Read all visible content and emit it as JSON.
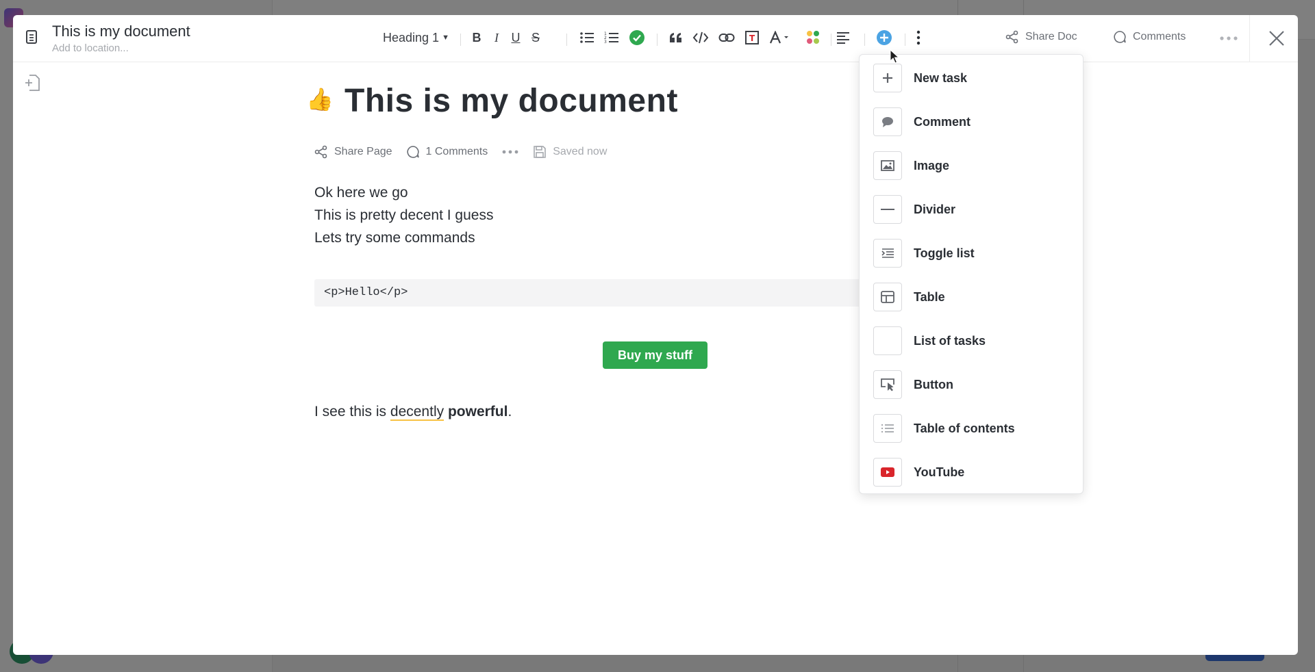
{
  "header": {
    "doc_title": "This is my document",
    "location_placeholder": "Add to location...",
    "heading_select": "Heading 1",
    "bold": "B",
    "italic": "I",
    "underline": "U",
    "strike": "S",
    "share_doc": "Share Doc",
    "comments": "Comments"
  },
  "page": {
    "emoji": "👍",
    "title": "This is my document",
    "share_page": "Share Page",
    "comments_count": "1 Comments",
    "saved": "Saved now",
    "lines": [
      "Ok here we go",
      "This is pretty decent I guess",
      "Lets try some commands"
    ],
    "code": "<p>Hello</p>",
    "button_label": "Buy my stuff",
    "final_line": {
      "prefix": "I see this is ",
      "highlight": "decently",
      "space": " ",
      "bold": "powerful",
      "suffix": "."
    }
  },
  "insert_menu": {
    "items": [
      {
        "label": "New task",
        "icon": "plus-icon"
      },
      {
        "label": "Comment",
        "icon": "comment-icon"
      },
      {
        "label": "Image",
        "icon": "image-icon"
      },
      {
        "label": "Divider",
        "icon": "divider-icon"
      },
      {
        "label": "Toggle list",
        "icon": "toggle-list-icon"
      },
      {
        "label": "Table",
        "icon": "table-icon"
      },
      {
        "label": "List of tasks",
        "icon": "list-of-tasks-icon"
      },
      {
        "label": "Button",
        "icon": "button-icon"
      },
      {
        "label": "Table of contents",
        "icon": "table-of-contents-icon"
      },
      {
        "label": "YouTube",
        "icon": "youtube-icon"
      }
    ]
  },
  "colors": {
    "accent": "#4ba3e3",
    "green": "#2fa84f",
    "youtube": "#d9252b",
    "highlight_underline": "#f7c244"
  }
}
